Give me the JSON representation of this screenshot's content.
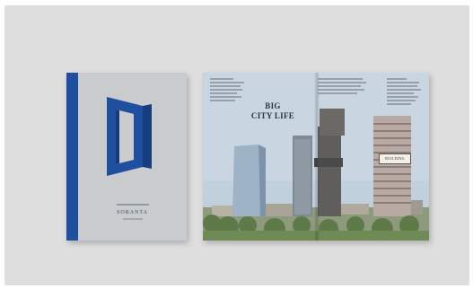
{
  "cover": {
    "brand": "SORANTA",
    "accent_color": "#1f4f9f"
  },
  "spread": {
    "headline_line1": "BIG",
    "headline_line2": "CITY LIFE",
    "badge_text": "BUILDING"
  }
}
